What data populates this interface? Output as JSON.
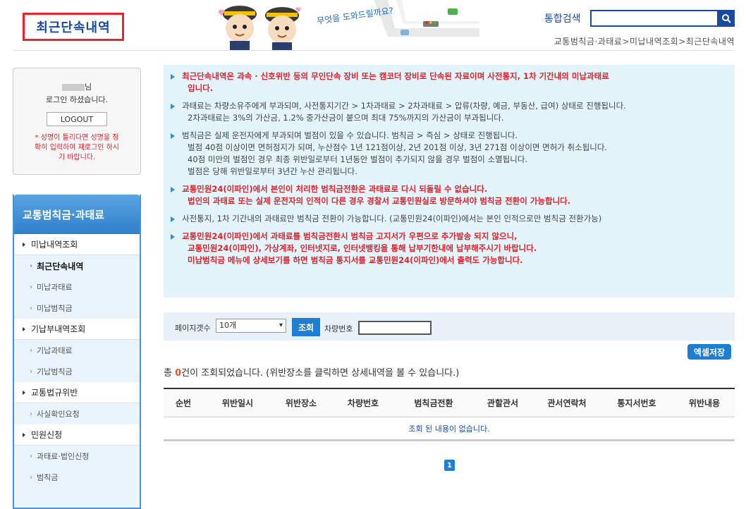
{
  "header": {
    "page_title": "최근단속내역",
    "mascot_caption": "무엇을 도와드릴까요?",
    "search_label": "통합검색",
    "breadcrumb": "교통범칙금·과태료>미납내역조회>최근단속내역"
  },
  "login": {
    "suffix": "님",
    "status": "로그인 하셨습니다.",
    "logout_label": "LOGOUT",
    "warning": "* 성명이 틀리다면 성명을 정확히 입력하여 재로그인 하시기 바랍니다."
  },
  "sidebar": {
    "title": "교통범칙금·과태료",
    "items": [
      {
        "label": "미납내역조회",
        "kind": "main"
      },
      {
        "label": "최근단속내역",
        "kind": "sub-active"
      },
      {
        "label": "미납과태료",
        "kind": "sub"
      },
      {
        "label": "미납범칙금",
        "kind": "sub"
      },
      {
        "label": "기납부내역조회",
        "kind": "main"
      },
      {
        "label": "기납과태료",
        "kind": "sub"
      },
      {
        "label": "기납범칙금",
        "kind": "sub"
      },
      {
        "label": "교통법규위반",
        "kind": "main"
      },
      {
        "label": "사실확인요청",
        "kind": "sub"
      },
      {
        "label": "민원신청",
        "kind": "main"
      },
      {
        "label": "과태료·법인신청",
        "kind": "sub"
      },
      {
        "label": "범칙금",
        "kind": "sub"
      }
    ]
  },
  "info": {
    "items": [
      {
        "red": true,
        "lines": [
          "최근단속내역은 과속 · 신호위반 등의 무인단속 장비 또는 캠코더 장비로 단속된 자료이며 사전통지, 1차 기간내의 미납과태료",
          "입니다."
        ]
      },
      {
        "red": false,
        "lines": [
          "과태료는 차량소유주에게 부과되며, 사전통지기간 > 1차과태료 > 2차과태료 > 압류(차량, 예금, 부동산, 급여) 상태로 진행됩니다.",
          "2차과태료는 3%의 가산금, 1.2% 중가산금이 붙으며 최대 75%까지의 가산금이 부과됩니다."
        ]
      },
      {
        "red": false,
        "lines": [
          "범칙금은 실제 운전자에게 부과되며 벌점이 있을 수 있습니다. 범칙금 > 즉심 > 상태로 진행됩니다.",
          "벌점 40점 이상이면 면허정지가 되며, 누산점수 1년 121점이상, 2년 201점 이상, 3년 271점 이상이면 면허가 취소됩니다.",
          "40점 미만의 벌점인 경우 최종 위반일로부터 1년동안 벌점이 추가되지 않을 경우 벌점이 소멸됩니다.",
          "벌점은 당해 위반일로부터 3년간 누산 관리됩니다."
        ]
      },
      {
        "red": true,
        "lines": [
          "교통민원24(이파인)에서 본인이 처리한 범칙금전환은 과태료로 다시 되돌릴 수 없습니다.",
          "법인의 과태료 또는 실제 운전자의 인적이 다른 경우 경찰서 교통민원실로 방문하셔야 범칙금 전환이 가능합니다."
        ]
      },
      {
        "red": false,
        "lines": [
          "사전통지, 1차 기간내의 과태료만 범칙금 전환이 가능합니다. (교통민원24(이파인)에서는 본인 인적으로만 범칙금 전환가능)"
        ]
      },
      {
        "red": true,
        "lines": [
          "교통민원24(이파인)에서 과태료를 범칙금전환시 범칙금 고지서가 우편으로 추가발송 되지 않으니,",
          "교통민원24(이파인), 가상계좌, 인터넷지로, 인터넷뱅킹을 통해 납부기한내에 납부해주시기 바랍니다.",
          "미납범칙금 메뉴에 상세보기를 하면 범칙금 통지서를 교통민원24(이파인)에서 출력도 가능합니다."
        ]
      }
    ]
  },
  "query": {
    "page_count_label": "페이지갯수",
    "page_count_value": "10개",
    "search_button": "조회",
    "car_number_label": "차량번호",
    "car_number_value": ""
  },
  "excel_button": "엑셀저장",
  "result": {
    "prefix": "총 ",
    "count": "0",
    "suffix": "건이 조회되었습니다. (위반장소를 클릭하면 상세내역을 볼 수 있습니다.)"
  },
  "table": {
    "columns": [
      "순번",
      "위반일시",
      "위반장소",
      "차량번호",
      "범칙금전환",
      "관할관서",
      "관서연락처",
      "통지서번호",
      "위반내용"
    ],
    "empty_message": "조회 된 내용이 없습니다."
  },
  "pagination": {
    "current": "1"
  },
  "colors": {
    "brand_blue": "#1a4aa0",
    "accent_blue": "#1e7ed1",
    "warning_red": "#d9242e",
    "info_bg": "#e4f4fb"
  }
}
